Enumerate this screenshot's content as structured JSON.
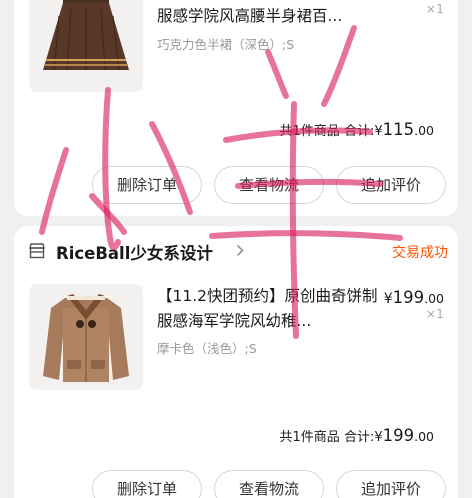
{
  "orders": [
    {
      "product_title": "服感学院风高腰半身裙百...",
      "spec": "巧克力色半裙（深色）;S",
      "quantity": "×1",
      "summary_count": "共1件商品",
      "summary_total_label": "合计:",
      "summary_currency": "¥",
      "summary_total_int": "115",
      "summary_total_dec": ".00",
      "actions": [
        "删除订单",
        "查看物流",
        "追加评价"
      ]
    },
    {
      "shop_icon": "store-icon",
      "shop_name": "RiceBall少女系设计",
      "status": "交易成功",
      "product_title": "【11.2快团预约】原创曲奇饼制服感海军学院风幼稚...",
      "spec": "摩卡色（浅色）;S",
      "price_currency": "¥",
      "price_int": "199",
      "price_dec": ".00",
      "quantity": "×1",
      "summary_count": "共1件商品",
      "summary_total_label": "合计:",
      "summary_currency": "¥",
      "summary_total_int": "199",
      "summary_total_dec": ".00",
      "actions": [
        "删除订单",
        "查看物流",
        "追加评价"
      ]
    }
  ],
  "colors": {
    "status_accent": "#ff5500",
    "watermark": "#d81b60",
    "background": "#f0f0f0"
  }
}
